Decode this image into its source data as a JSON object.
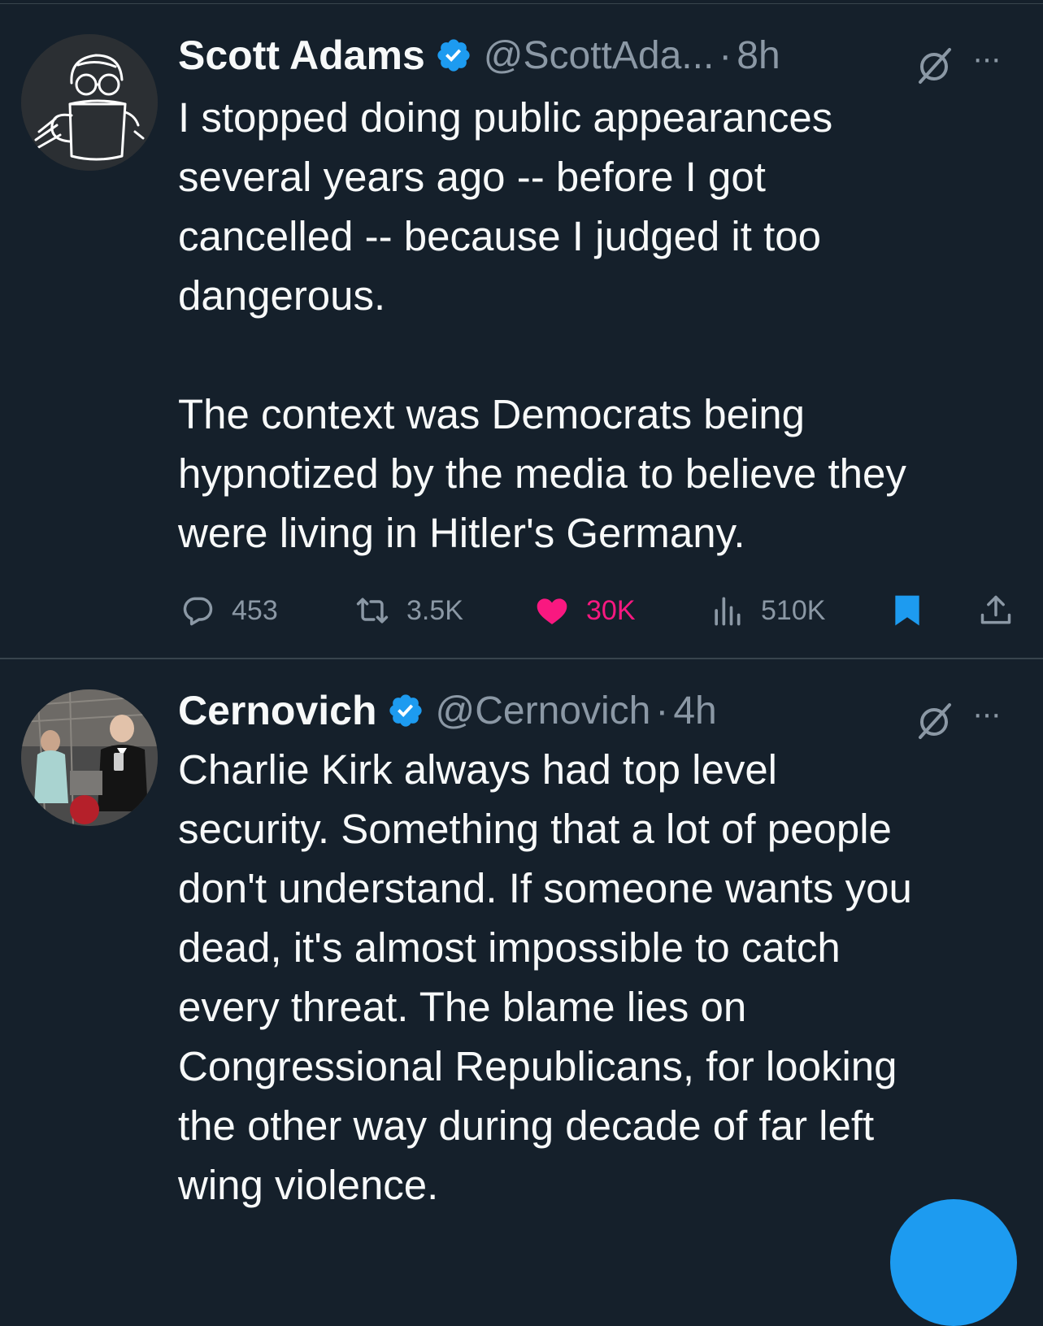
{
  "tweets": [
    {
      "name": "Scott Adams",
      "handle": "@ScottAda...",
      "separator": "·",
      "time": "8h",
      "more": "···",
      "paragraphs": [
        "I stopped doing public appearances\nseveral years ago -- before I got\ncancelled -- because I judged it too\ndangerous.",
        "The context was Democrats being\nhypnotized by the media to believe they\nwere living in Hitler's Germany."
      ],
      "actions": {
        "replies": "453",
        "retweets": "3.5K",
        "likes": "30K",
        "views": "510K"
      },
      "liked": true,
      "bookmarked": true
    },
    {
      "name": "Cernovich",
      "handle": "@Cernovich",
      "separator": "·",
      "time": "4h",
      "more": "···",
      "paragraphs": [
        "Charlie Kirk always had top level\nsecurity. Something that a lot of people\ndon't understand. If someone wants you\ndead, it's almost impossible to catch\nevery threat. The blame lies on\nCongressional Republicans, for looking\nthe other way during decade of far left\nwing violence."
      ]
    }
  ],
  "colors": {
    "background": "#15202b",
    "text": "#f7f9f9",
    "muted": "#8b98a5",
    "accent": "#1d9bf0",
    "like": "#f91880",
    "divider": "#38444d"
  },
  "icons": [
    "verified-badge-icon",
    "mute-icon",
    "more-icon",
    "reply-icon",
    "retweet-icon",
    "like-icon",
    "views-icon",
    "bookmark-icon",
    "share-icon",
    "compose-icon"
  ]
}
